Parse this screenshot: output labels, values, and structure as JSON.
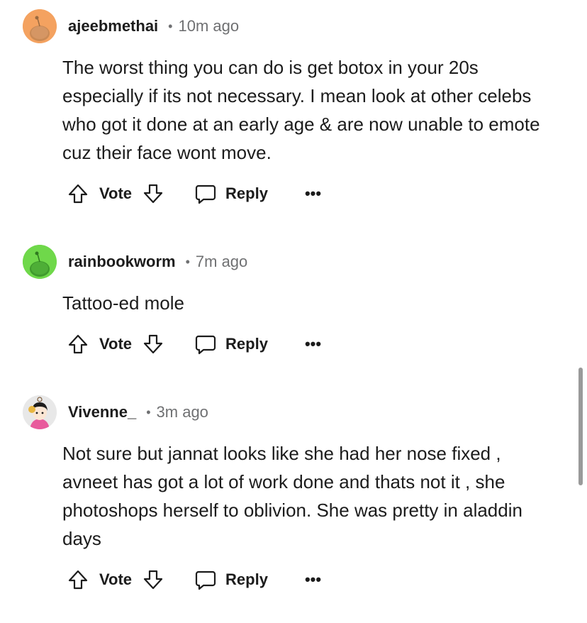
{
  "comments": [
    {
      "username": "ajeebmethai",
      "separator": "•",
      "time": "10m ago",
      "avatar_color": "#f4a260",
      "body": "The worst thing you can do is get botox in your 20s especially if its not necessary. I mean look at other celebs who got it done at an early age & are now unable to emote cuz their face wont move.",
      "vote_label": "Vote",
      "reply_label": "Reply",
      "more_label": "•••"
    },
    {
      "username": "rainbookworm",
      "separator": "•",
      "time": "7m ago",
      "avatar_color": "#6fd84a",
      "body": "Tattoo-ed mole",
      "vote_label": "Vote",
      "reply_label": "Reply",
      "more_label": "•••"
    },
    {
      "username": "Vivenne_",
      "separator": "•",
      "time": "3m ago",
      "avatar_color": "#e8e8e8",
      "body": "Not sure but jannat looks like she had her nose fixed , avneet has got a lot of work done and thats not it , she photoshops herself to oblivion. She was pretty in aladdin days",
      "vote_label": "Vote",
      "reply_label": "Reply",
      "more_label": "•••"
    }
  ]
}
